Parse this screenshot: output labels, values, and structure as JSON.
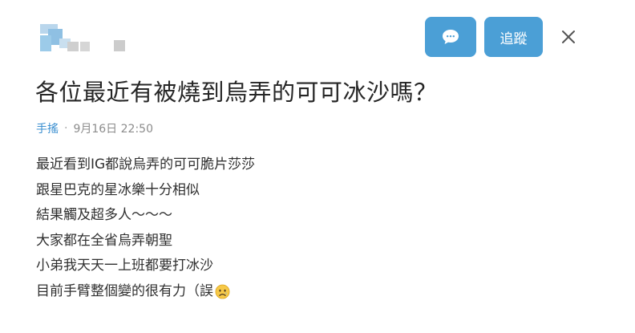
{
  "header": {
    "follow_label": "追蹤"
  },
  "post": {
    "title": "各位最近有被燒到烏弄的可可冰沙嗎？",
    "board": "手搖",
    "date": "9月16日 22:50",
    "lines": [
      "最近看到IG都說烏弄的可可脆片莎莎",
      "跟星巴克的星冰樂十分相似",
      "結果觸及超多人～～～",
      "大家都在全省烏弄朝聖",
      "小弟我天天一上班都要打冰沙",
      "目前手臂整個變的很有力（誤"
    ]
  },
  "colors": {
    "button_bg": "#4b9fd6",
    "board_link": "#3b8fd0",
    "title_text": "#262626",
    "body_text": "#2f2f2f"
  },
  "icons": {
    "message_button": "chat-bubble-icon",
    "close_button": "close-icon",
    "last_line_emoji": "sad-face-emoji"
  }
}
